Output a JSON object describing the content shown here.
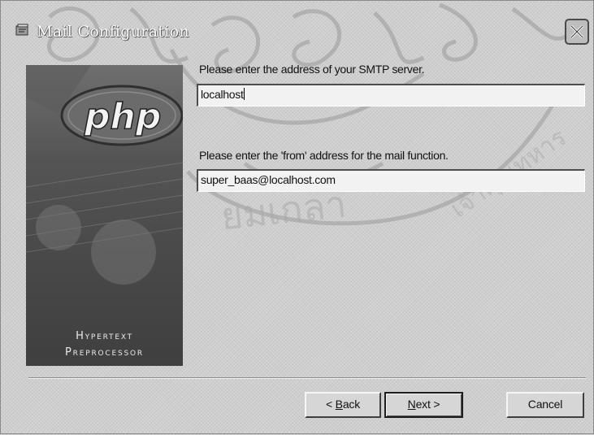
{
  "window": {
    "title": "Mail Configuration",
    "icon": "installer-icon",
    "close_icon": "close-icon"
  },
  "banner": {
    "logo_text": "php",
    "line1": "Hypertext",
    "line2": "Preprocessor"
  },
  "smtp": {
    "label": "Please enter the address of your SMTP server.",
    "value": "localhost"
  },
  "from": {
    "label": "Please enter the 'from' address for the mail function.",
    "value": "super_baas@localhost.com"
  },
  "buttons": {
    "back_mnemonic": "B",
    "back_rest": "ack",
    "back_prefix": "< ",
    "next_mnemonic": "N",
    "next_rest": "ext",
    "next_suffix": " >",
    "cancel": "Cancel"
  },
  "watermark": {
    "text": "ยมเกลาเจ้าคุณทหาร"
  }
}
